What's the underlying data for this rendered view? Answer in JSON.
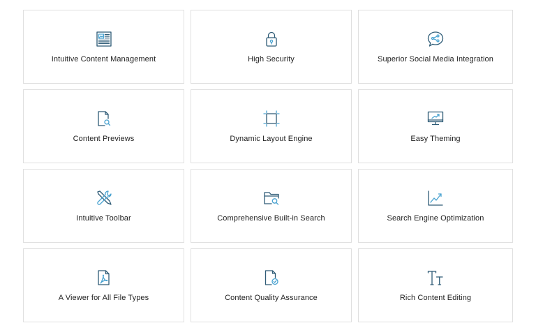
{
  "features": [
    {
      "label": "Intuitive Content Management",
      "icon": "content-management-icon"
    },
    {
      "label": "High Security",
      "icon": "lock-icon"
    },
    {
      "label": "Superior Social Media Integration",
      "icon": "share-bubble-icon"
    },
    {
      "label": "Content Previews",
      "icon": "document-search-icon"
    },
    {
      "label": "Dynamic Layout Engine",
      "icon": "layout-crop-icon"
    },
    {
      "label": "Easy Theming",
      "icon": "monitor-icon"
    },
    {
      "label": "Intuitive Toolbar",
      "icon": "tools-icon"
    },
    {
      "label": "Comprehensive Built-in Search",
      "icon": "folder-search-icon"
    },
    {
      "label": "Search Engine Optimization",
      "icon": "growth-chart-icon"
    },
    {
      "label": "A Viewer for All File Types",
      "icon": "pdf-file-icon"
    },
    {
      "label": "Content Quality Assurance",
      "icon": "document-check-icon"
    },
    {
      "label": "Rich Content Editing",
      "icon": "text-size-icon"
    }
  ],
  "colors": {
    "icon_dark": "#2e5b76",
    "icon_accent": "#4aa3d1",
    "border": "#e0e0e0",
    "text": "#222222"
  }
}
